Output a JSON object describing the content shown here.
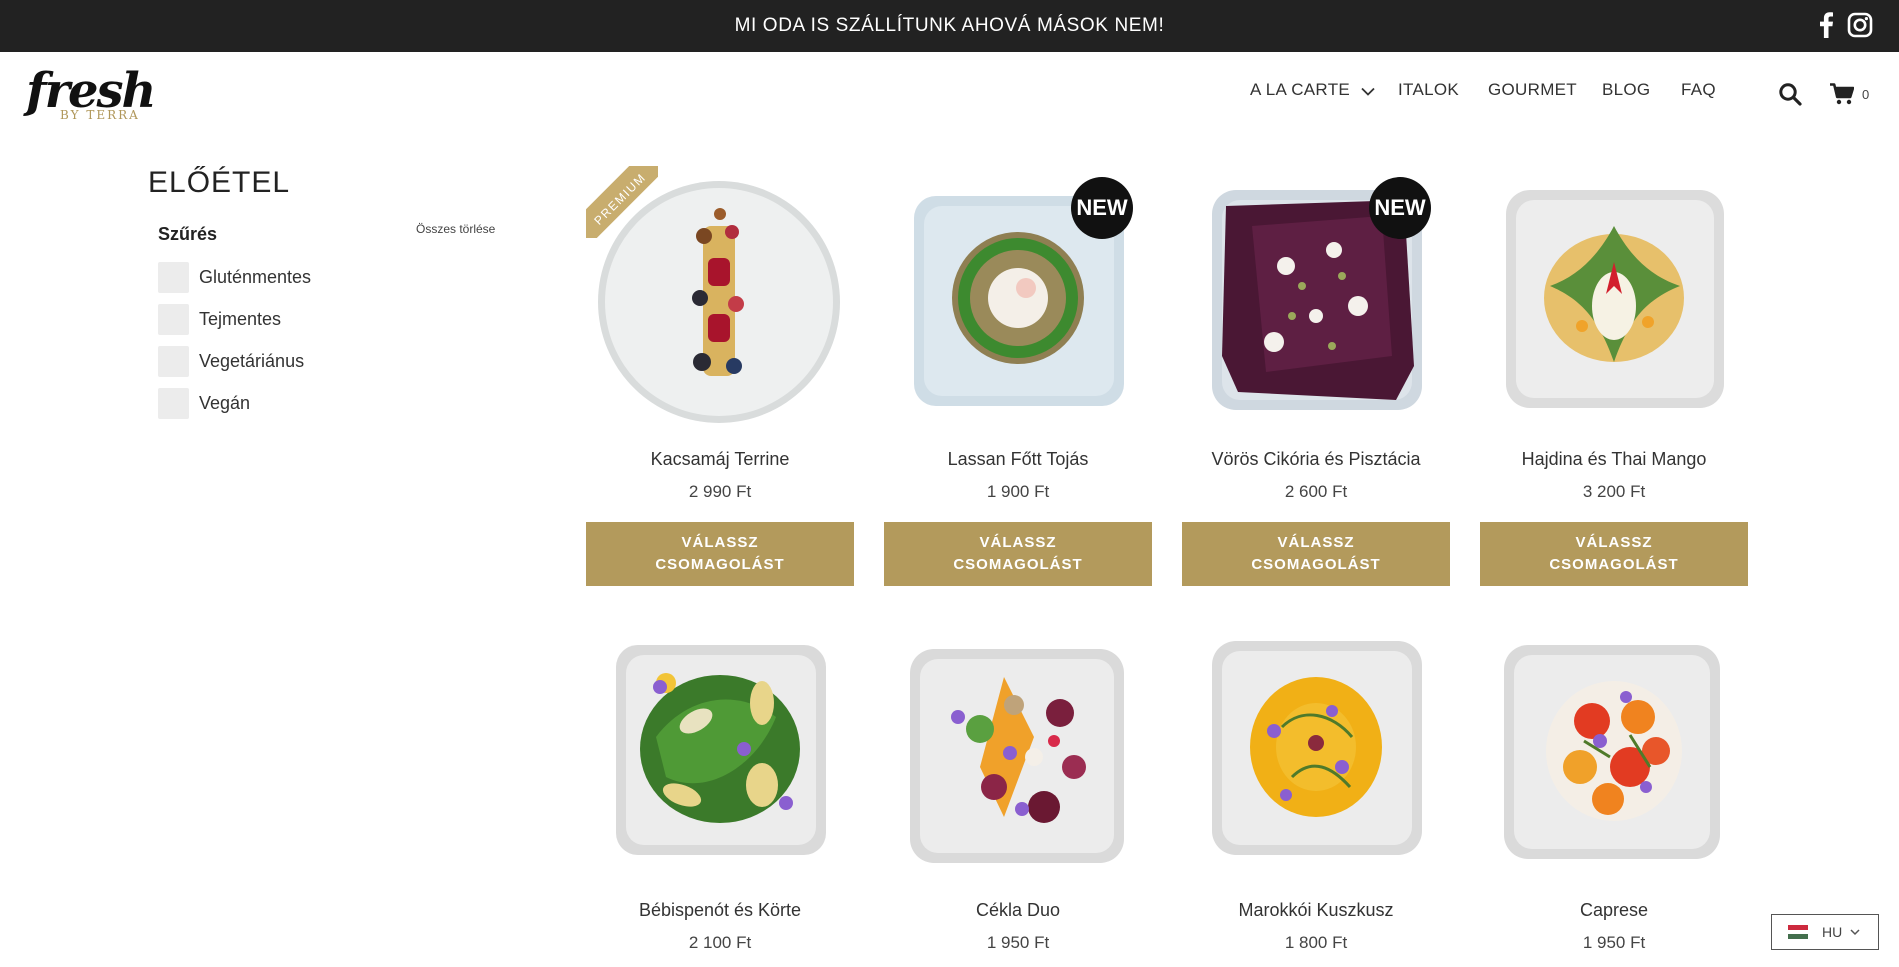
{
  "announcement": "MI ODA IS SZÁLLÍTUNK AHOVÁ MÁSOK NEM!",
  "social": {
    "facebook_icon": "facebook-icon",
    "instagram_icon": "instagram-icon"
  },
  "logo": {
    "main": "fresh",
    "sub": "BY TERRA"
  },
  "nav": {
    "items": [
      {
        "label": "A LA CARTE",
        "has_dropdown": true
      },
      {
        "label": "ITALOK"
      },
      {
        "label": "GOURMET"
      },
      {
        "label": "BLOG"
      },
      {
        "label": "FAQ"
      }
    ],
    "cart_count": "0"
  },
  "category": {
    "title": "ELŐÉTEL"
  },
  "filters": {
    "title": "Szűrés",
    "clear_label": "Összes törlése",
    "options": [
      "Gluténmentes",
      "Tejmentes",
      "Vegetáriánus",
      "Vegán"
    ]
  },
  "products": [
    {
      "name": "Kacsamáj Terrine",
      "price": "2 990 Ft",
      "cta": "VÁLASSZ CSOMAGOLÁST",
      "badge": "PREMIUM"
    },
    {
      "name": "Lassan Főtt Tojás",
      "price": "1 900 Ft",
      "cta": "VÁLASSZ CSOMAGOLÁST",
      "badge": "NEW"
    },
    {
      "name": "Vörös Cikória és Pisztácia",
      "price": "2 600 Ft",
      "cta": "VÁLASSZ CSOMAGOLÁST",
      "badge": "NEW"
    },
    {
      "name": "Hajdina és Thai Mango",
      "price": "3 200 Ft",
      "cta": "VÁLASSZ CSOMAGOLÁST",
      "badge": ""
    },
    {
      "name": "Bébispenót és Körte",
      "price": "2 100 Ft",
      "cta": "",
      "badge": ""
    },
    {
      "name": "Cékla Duo",
      "price": "1 950 Ft",
      "cta": "",
      "badge": ""
    },
    {
      "name": "Marokkói Kuszkusz",
      "price": "1 800 Ft",
      "cta": "",
      "badge": ""
    },
    {
      "name": "Caprese",
      "price": "1 950 Ft",
      "cta": "",
      "badge": ""
    }
  ],
  "language": {
    "code": "HU",
    "flag_colors": [
      "#cd2a3e",
      "#ffffff",
      "#436f4d"
    ]
  },
  "colors": {
    "topbar": "#222222",
    "accent_gold": "#b39a5c",
    "badge_black": "#111111"
  }
}
